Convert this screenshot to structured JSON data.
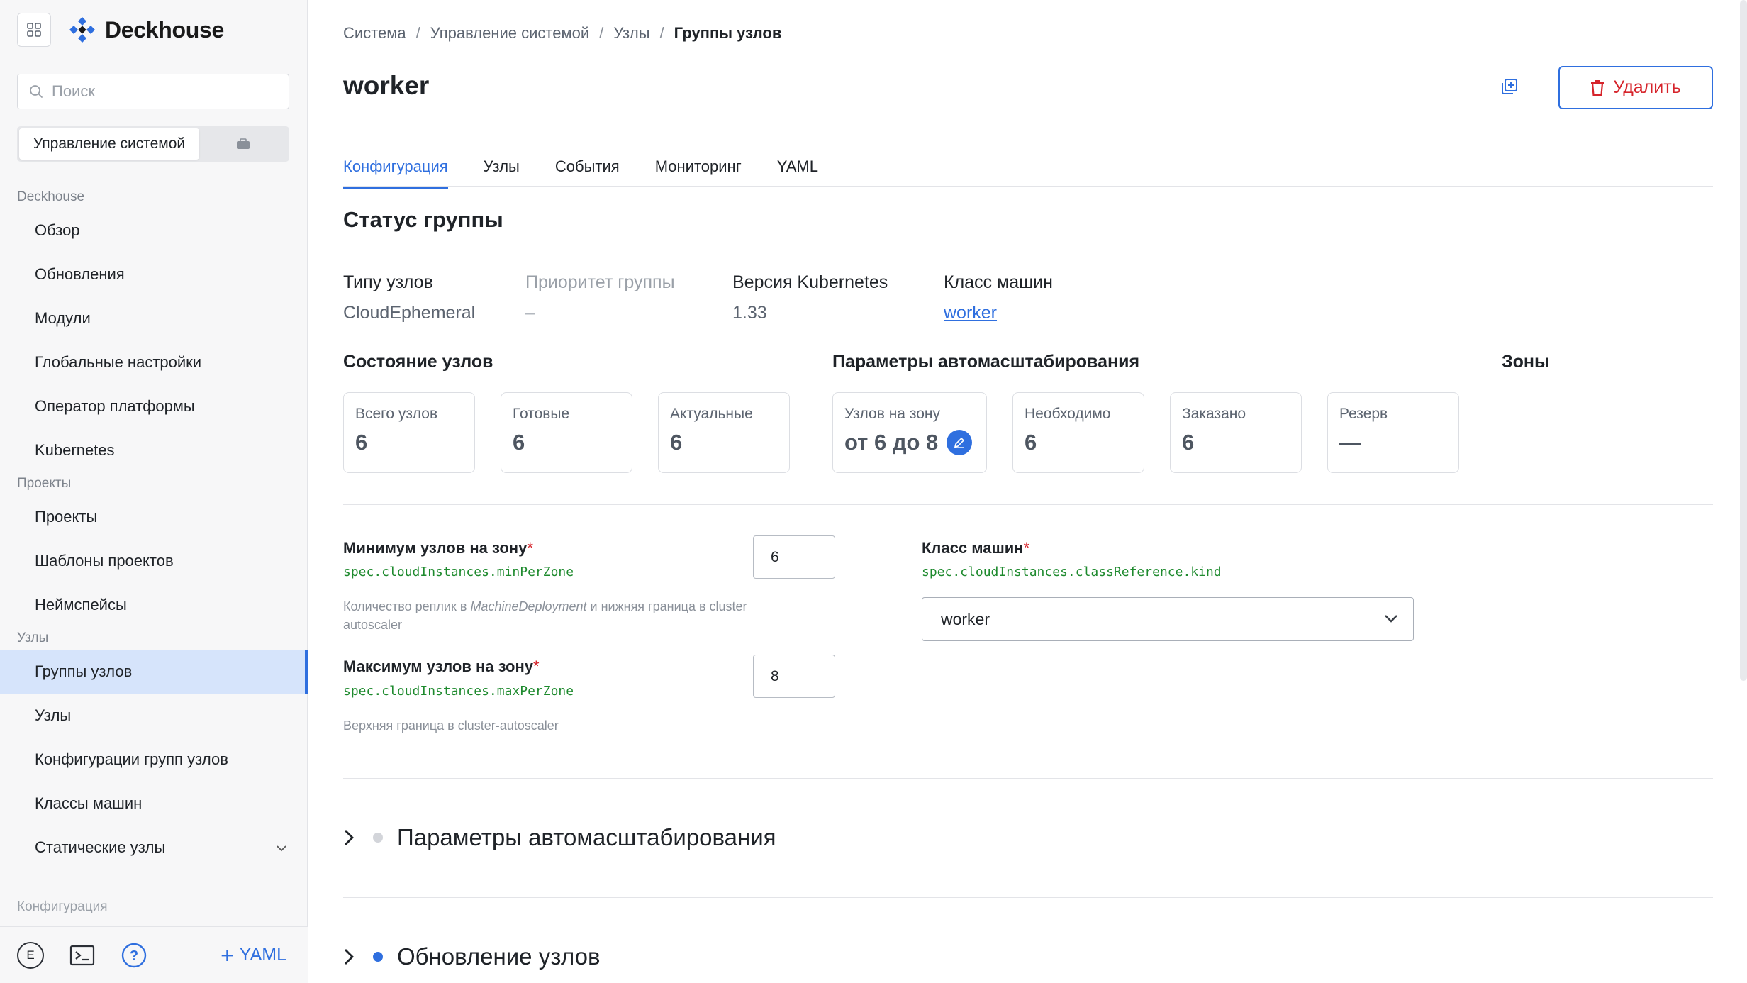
{
  "app": {
    "name": "Deckhouse"
  },
  "sidebar": {
    "search_placeholder": "Поиск",
    "segment_active": "Управление системой",
    "sections": [
      {
        "title": "Deckhouse",
        "items": [
          "Обзор",
          "Обновления",
          "Модули",
          "Глобальные настройки",
          "Оператор платформы",
          "Kubernetes"
        ]
      },
      {
        "title": "Проекты",
        "items": [
          "Проекты",
          "Шаблоны проектов",
          "Неймспейсы"
        ]
      },
      {
        "title": "Узлы",
        "items": [
          "Группы узлов",
          "Узлы",
          "Конфигурации групп узлов",
          "Классы машин",
          "Статические узлы"
        ]
      }
    ],
    "active_item": "Группы узлов",
    "next_section": "Конфигурация",
    "bottom": {
      "avatar_letter": "E",
      "yaml_label": "YAML"
    }
  },
  "breadcrumb": [
    "Система",
    "Управление системой",
    "Узлы",
    "Группы узлов"
  ],
  "page": {
    "title": "worker",
    "delete_label": "Удалить",
    "tabs": [
      "Конфигурация",
      "Узлы",
      "События",
      "Мониторинг",
      "YAML"
    ],
    "active_tab": "Конфигурация"
  },
  "status": {
    "title": "Статус группы",
    "info": [
      {
        "label": "Типу узлов",
        "value": "CloudEphemeral"
      },
      {
        "label": "Приоритет группы",
        "value": "–"
      },
      {
        "label": "Версия Kubernetes",
        "value": "1.33"
      },
      {
        "label": "Класс машин",
        "value": "worker"
      }
    ],
    "node_state_label": "Состояние узлов",
    "autoscaling_label": "Параметры автомасштабирования",
    "zones_label": "Зоны",
    "cards": [
      {
        "label": "Всего узлов",
        "value": "6"
      },
      {
        "label": "Готовые",
        "value": "6"
      },
      {
        "label": "Актуальные",
        "value": "6"
      },
      {
        "label": "Узлов на зону",
        "value": "от 6 до 8"
      },
      {
        "label": "Необходимо",
        "value": "6"
      },
      {
        "label": "Заказано",
        "value": "6"
      },
      {
        "label": "Резерв",
        "value": "—"
      }
    ]
  },
  "form": {
    "min": {
      "label": "Минимум узлов на зону",
      "path": "spec.cloudInstances.minPerZone",
      "help_prefix": "Количество реплик в ",
      "help_em": "MachineDeployment",
      "help_suffix": " и нижняя граница в cluster autoscaler",
      "value": "6"
    },
    "max": {
      "label": "Максимум узлов на зону",
      "path": "spec.cloudInstances.maxPerZone",
      "help": "Верхняя граница в cluster-autoscaler",
      "value": "8"
    },
    "class": {
      "label": "Класс машин",
      "path": "spec.cloudInstances.classReference.kind",
      "value": "worker"
    },
    "required_mark": "*"
  },
  "accordions": [
    {
      "title": "Параметры автомасштабирования",
      "dot_color": "#d3d5da"
    },
    {
      "title": "Обновление узлов",
      "dot_color": "#2f6fdf"
    }
  ],
  "colors": {
    "accent": "#2f6fdf",
    "danger": "#d6242b",
    "code": "#1e8a2e"
  }
}
